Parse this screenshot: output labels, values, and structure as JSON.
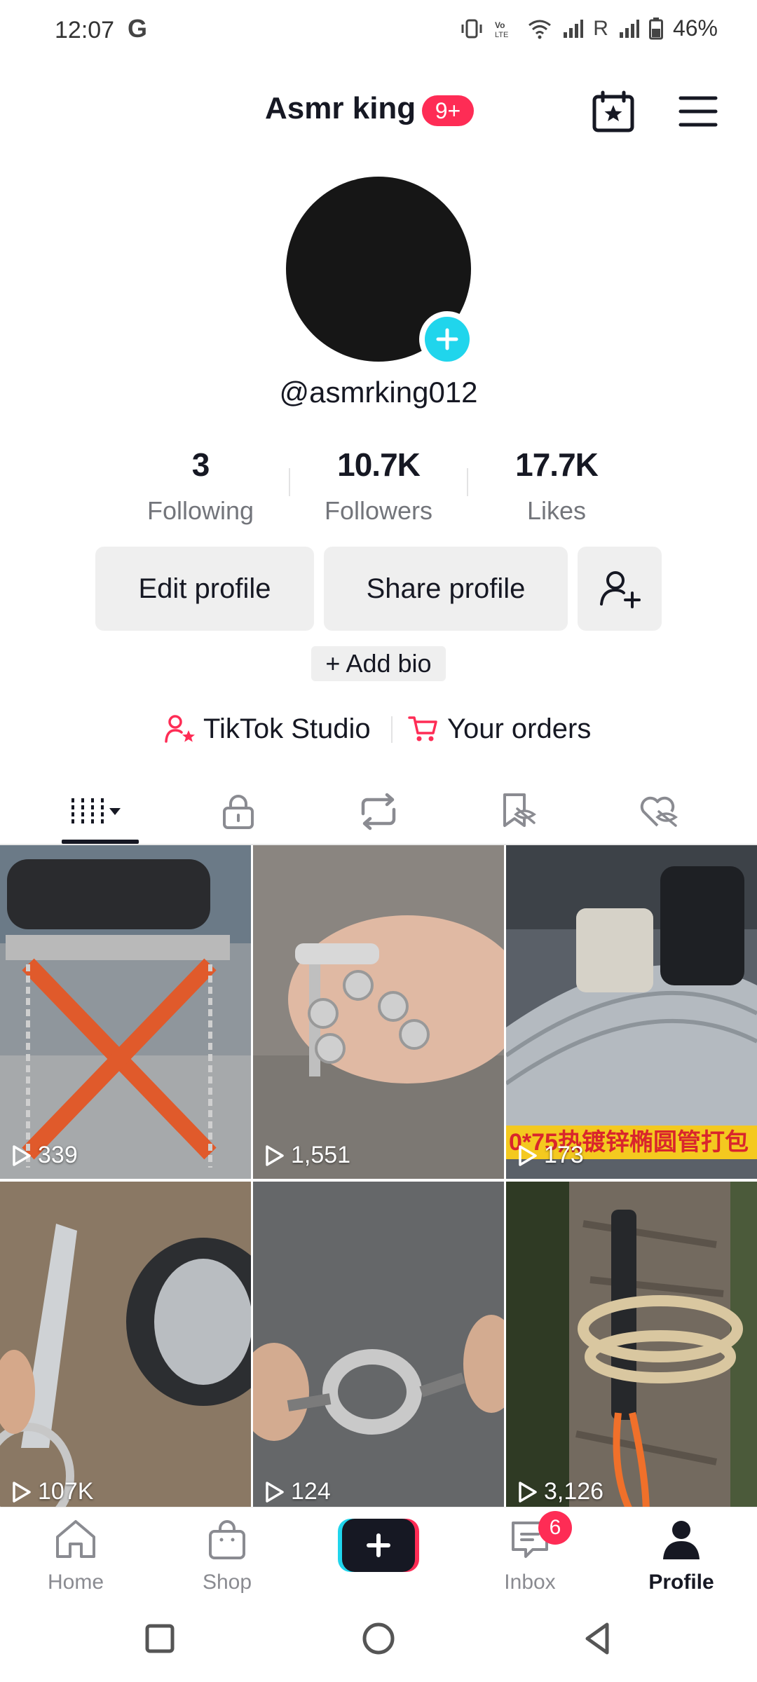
{
  "status_bar": {
    "time": "12:07",
    "carrier_icon": "G",
    "roaming": "R",
    "battery_percent": "46%"
  },
  "header": {
    "title": "Asmr king",
    "notification_badge": "9+"
  },
  "profile": {
    "handle": "@asmrking012",
    "stats": [
      {
        "value": "3",
        "label": "Following"
      },
      {
        "value": "10.7K",
        "label": "Followers"
      },
      {
        "value": "17.7K",
        "label": "Likes"
      }
    ],
    "buttons": {
      "edit": "Edit profile",
      "share": "Share profile"
    },
    "add_bio": "+ Add bio",
    "links": {
      "studio": "TikTok Studio",
      "orders": "Your orders"
    }
  },
  "tabs": [
    "videos-grid-icon",
    "lock-icon",
    "repost-icon",
    "bookmark-icon",
    "liked-icon"
  ],
  "videos": [
    {
      "views": "339"
    },
    {
      "views": "1,551"
    },
    {
      "views": "173",
      "caption": "0*75热镀锌椭圆管打包"
    },
    {
      "views": "107K"
    },
    {
      "views": "124"
    },
    {
      "views": "3,126"
    }
  ],
  "bottom_nav": {
    "home": "Home",
    "shop": "Shop",
    "inbox": "Inbox",
    "inbox_badge": "6",
    "profile": "Profile"
  },
  "colors": {
    "accent_red": "#fe2c55",
    "accent_cyan": "#20d5ec",
    "text_primary": "#161823",
    "text_secondary": "#73757b",
    "button_bg": "#efefef"
  }
}
